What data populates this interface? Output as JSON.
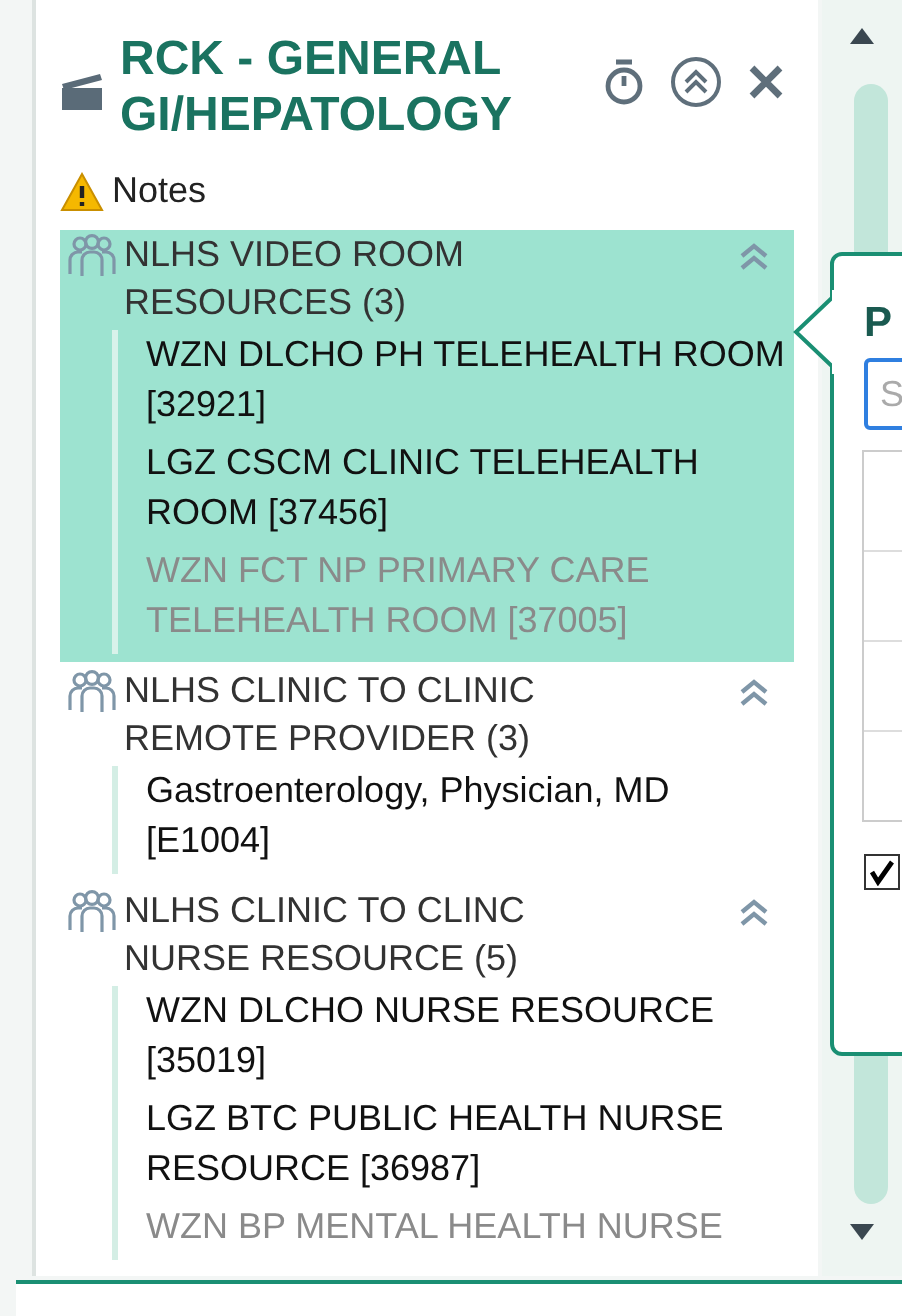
{
  "panel": {
    "title": "RCK - GENERAL GI/HEPATOLOGY",
    "notes": "Notes",
    "groups": [
      {
        "label": "NLHS VIDEO ROOM RESOURCES (3)",
        "selected": true,
        "expanded": true,
        "items": [
          {
            "label": "WZN DLCHO PH TELEHEALTH ROOM [32921]",
            "faded": false
          },
          {
            "label": "LGZ CSCM CLINIC TELEHEALTH ROOM [37456]",
            "faded": false
          },
          {
            "label": "WZN FCT NP PRIMARY CARE TELEHEALTH ROOM [37005]",
            "faded": true
          }
        ]
      },
      {
        "label": "NLHS CLINIC TO CLINIC REMOTE PROVIDER (3)",
        "selected": false,
        "expanded": true,
        "items": [
          {
            "label": "Gastroenterology, Physician, MD [E1004]",
            "faded": false
          }
        ]
      },
      {
        "label": "NLHS CLINIC TO CLINC NURSE RESOURCE (5)",
        "selected": false,
        "expanded": true,
        "items": [
          {
            "label": "WZN DLCHO NURSE RESOURCE [35019]",
            "faded": false
          },
          {
            "label": "LGZ BTC PUBLIC HEALTH NURSE RESOURCE [36987]",
            "faded": false
          },
          {
            "label": "WZN BP MENTAL HEALTH NURSE",
            "faded": true
          }
        ]
      }
    ]
  },
  "popover": {
    "title": "P",
    "search": {
      "placeholder": "S"
    },
    "checkbox": {
      "checked": true
    }
  }
}
